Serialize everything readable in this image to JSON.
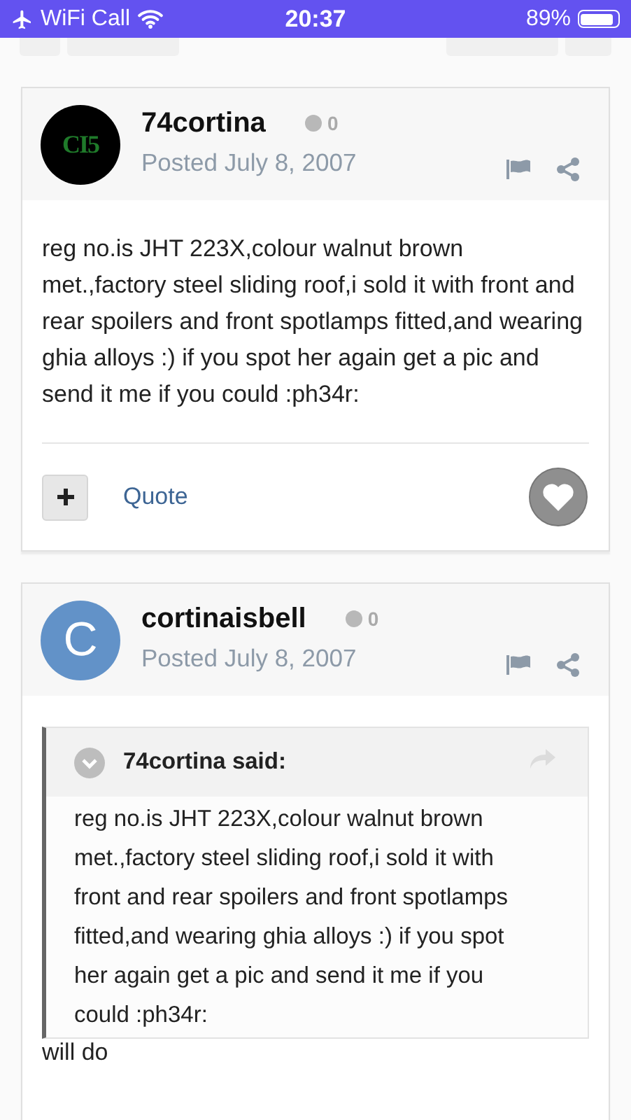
{
  "status_bar": {
    "carrier": "WiFi Call",
    "time": "20:37",
    "battery": "89%"
  },
  "posts": [
    {
      "author": "74cortina",
      "avatar": {
        "kind": "logo",
        "letter": "CI5"
      },
      "reputation": "0",
      "date": "Posted July 8, 2007",
      "body": "reg no.is JHT 223X,colour walnut brown met.,factory steel sliding roof,i sold it with front and rear spoilers and front spotlamps fitted,and wearing ghia alloys :) if you spot her again get a pic and send it me if you could :ph34r:",
      "footer": {
        "quote_label": "Quote",
        "liked": false
      }
    },
    {
      "author": "cortinaisbell",
      "avatar": {
        "kind": "letter",
        "letter": "C",
        "color": "#6292c8"
      },
      "reputation": "0",
      "date": "Posted July 8, 2007",
      "quote": {
        "header": "74cortina said:",
        "text": "reg no.is JHT 223X,colour walnut brown met.,factory steel sliding roof,i sold it with front and rear spoilers and front spotlamps fitted,and wearing ghia alloys :) if you spot her again get a pic and send it me if you could :ph34r:"
      },
      "body": "will do"
    }
  ]
}
